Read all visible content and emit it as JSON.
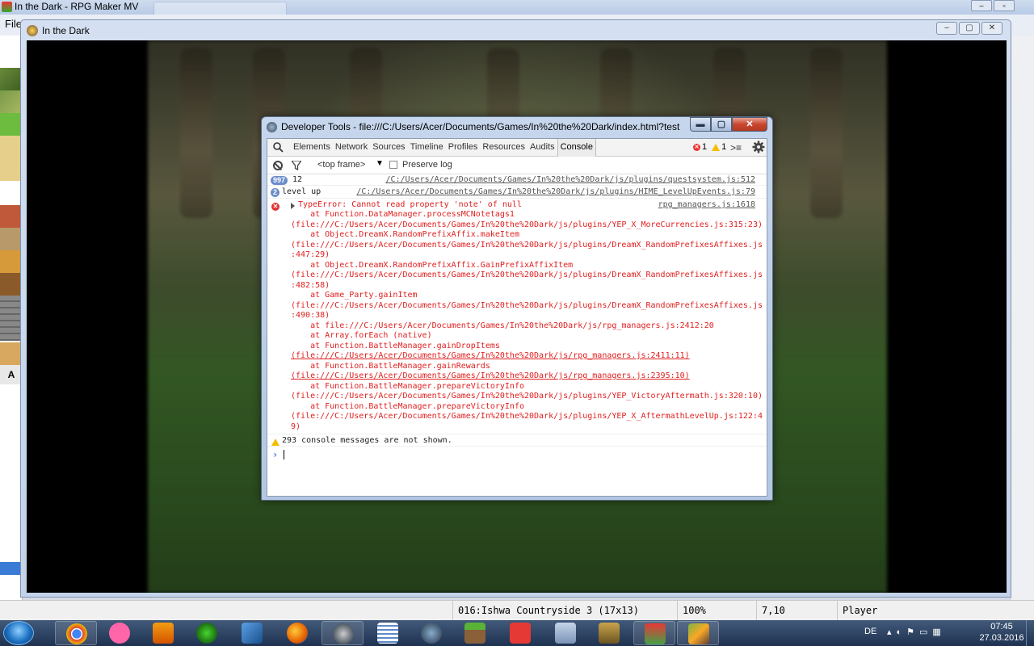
{
  "rpgmaker": {
    "window_title": "In the Dark - RPG Maker MV",
    "menu_file": "File",
    "status": {
      "map": "016:Ishwa Countryside 3 (17x13)",
      "zoom": "100%",
      "coords": "7,10",
      "mode": "Player"
    },
    "tileset_tab": "A"
  },
  "game": {
    "window_title": "In the Dark"
  },
  "devtools": {
    "title": "Developer Tools - file:///C:/Users/Acer/Documents/Games/In%20the%20Dark/index.html?test",
    "tabs": [
      "Elements",
      "Network",
      "Sources",
      "Timeline",
      "Profiles",
      "Resources",
      "Audits",
      "Console"
    ],
    "active_tab": "Console",
    "error_count": "1",
    "warning_count": "1",
    "frame_selector": "<top frame>",
    "preserve_log_label": "Preserve log",
    "messages": {
      "m1": {
        "repeat": "997",
        "text": "12",
        "source": "/C:/Users/Acer/Documents/Games/In%20the%20Dark/js/plugins/questsystem.js:512"
      },
      "m2": {
        "repeat": "2",
        "text": "level up",
        "source": "/C:/Users/Acer/Documents/Games/In%20the%20Dark/js/plugins/HIME_LevelUpEvents.js:79"
      },
      "error": {
        "head": "TypeError: Cannot read property 'note' of null",
        "source": "rpg_managers.js:1618",
        "lines": [
          "    at Function.DataManager.processMCNotetags1",
          "(file:///C:/Users/Acer/Documents/Games/In%20the%20Dark/js/plugins/YEP_X_MoreCurrencies.js:315:23)",
          "    at Object.DreamX.RandomPrefixAffix.makeItem",
          "(file:///C:/Users/Acer/Documents/Games/In%20the%20Dark/js/plugins/DreamX_RandomPrefixesAffixes.js",
          ":447:29)",
          "    at Object.DreamX.RandomPrefixAffix.GainPrefixAffixItem",
          "(file:///C:/Users/Acer/Documents/Games/In%20the%20Dark/js/plugins/DreamX_RandomPrefixesAffixes.js",
          ":482:58)",
          "    at Game_Party.gainItem",
          "(file:///C:/Users/Acer/Documents/Games/In%20the%20Dark/js/plugins/DreamX_RandomPrefixesAffixes.js",
          ":490:38)",
          "    at file:///C:/Users/Acer/Documents/Games/In%20the%20Dark/js/rpg_managers.js:2412:20",
          "    at Array.forEach (native)",
          "    at Function.BattleManager.gainDropItems",
          "(file:///C:/Users/Acer/Documents/Games/In%20the%20Dark/js/rpg_managers.js:2411:11)",
          "    at Function.BattleManager.gainRewards",
          "(file:///C:/Users/Acer/Documents/Games/In%20the%20Dark/js/rpg_managers.js:2395:10)",
          "    at Function.BattleManager.prepareVictoryInfo",
          "(file:///C:/Users/Acer/Documents/Games/In%20the%20Dark/js/plugins/YEP_VictoryAftermath.js:320:10)",
          "    at Function.BattleManager.prepareVictoryInfo",
          "(file:///C:/Users/Acer/Documents/Games/In%20the%20Dark/js/plugins/YEP_X_AftermathLevelUp.js:122:4",
          "9)"
        ]
      },
      "warning": "293 console messages are not shown."
    }
  },
  "taskbar": {
    "lang": "DE",
    "time": "07:45",
    "date": "27.03.2016",
    "apps": [
      "chrome-icon",
      "osu-icon",
      "media-player-icon",
      "razer-icon",
      "visual-studio-icon",
      "firefox-icon",
      "steam-icon",
      "notepad-icon",
      "fiddler-icon",
      "minecraft-icon",
      "pdf-icon",
      "games-icon",
      "league-icon",
      "rpgmaker-icon",
      "game-icon"
    ]
  },
  "colors": {
    "error_red": "#e02020",
    "link_gray": "#555555",
    "badge_blue": "#6b8dc9",
    "warning_yellow": "#f4bd00"
  }
}
